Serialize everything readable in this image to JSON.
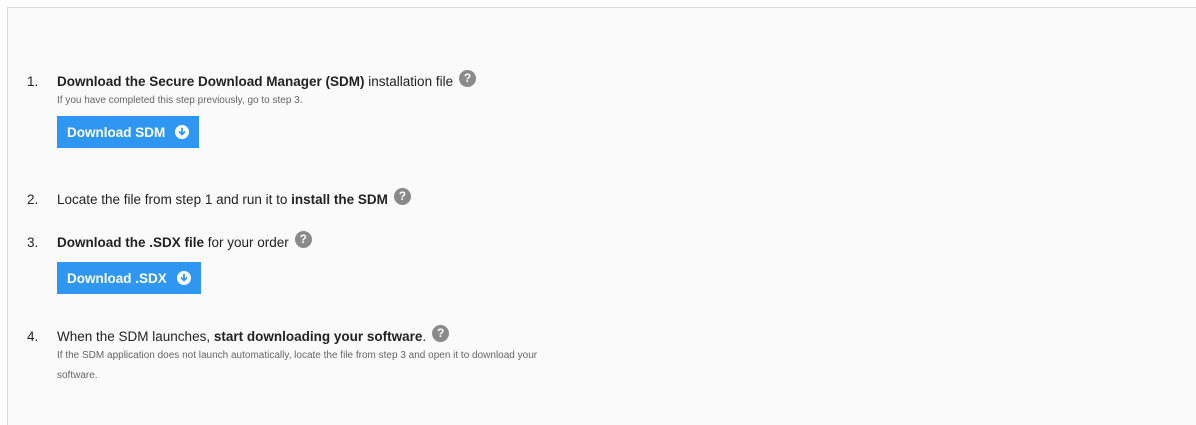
{
  "steps": {
    "one": {
      "number": "1.",
      "bold_text": "Download the Secure Download Manager (SDM)",
      "text": " installation file",
      "note": "If you have completed this step previously, go to step 3.",
      "button_label": "Download SDM"
    },
    "two": {
      "number": "2.",
      "text": "Locate the file from step 1 and run it to ",
      "bold_text": "install the SDM"
    },
    "three": {
      "number": "3.",
      "bold_text": "Download the .SDX file",
      "text": " for your order",
      "button_label": "Download .SDX"
    },
    "four": {
      "number": "4.",
      "text": "When the SDM launches, ",
      "bold_text": "start downloading your software",
      "text_after": ".",
      "note_line1": "If the SDM application does not launch automatically, locate the file from step 3 and open it to download your",
      "note_line2": "software."
    }
  },
  "icons": {
    "help": "question-circle-icon",
    "download": "arrow-down-circle-icon"
  },
  "colors": {
    "button_bg": "#2f97f2",
    "help_icon_bg": "#8a8a8a"
  }
}
